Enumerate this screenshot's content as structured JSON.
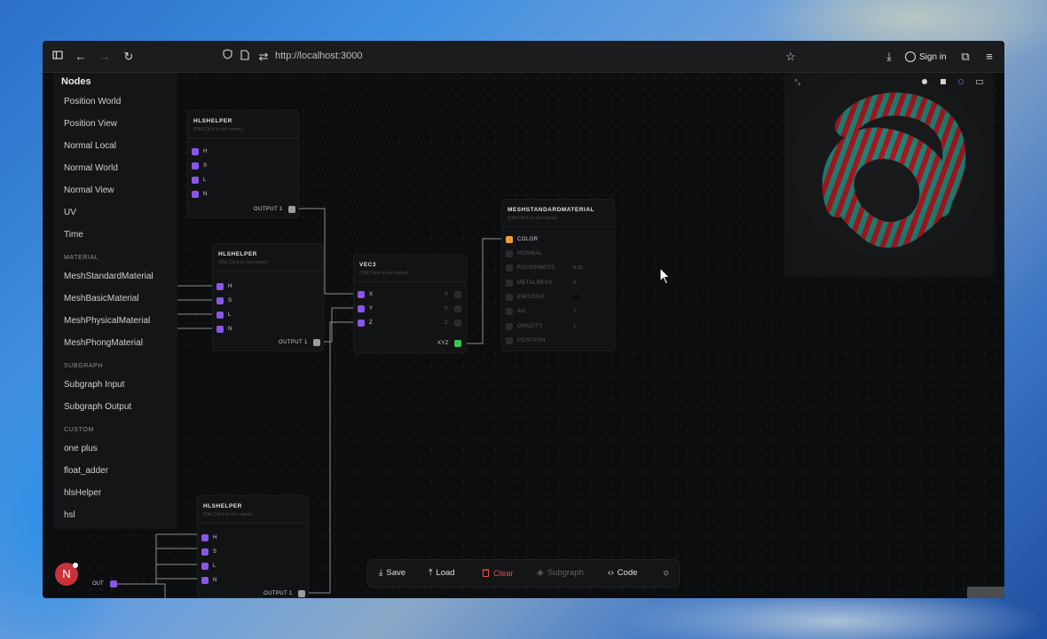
{
  "browser": {
    "url": "http://localhost:3000",
    "sign_in": "Sign in"
  },
  "sidebar": {
    "title": "Nodes",
    "items_top": [
      "Position World",
      "Position View",
      "Normal Local",
      "Normal World",
      "Normal View",
      "UV",
      "Time"
    ],
    "sections": [
      {
        "label": "MATERIAL",
        "items": [
          "MeshStandardMaterial",
          "MeshBasicMaterial",
          "MeshPhysicalMaterial",
          "MeshPhongMaterial"
        ]
      },
      {
        "label": "SUBGRAPH",
        "items": [
          "Subgraph Input",
          "Subgraph Output"
        ]
      },
      {
        "label": "CUSTOM",
        "items": [
          "one plus",
          "float_adder",
          "hlsHelper",
          "hsl"
        ]
      }
    ]
  },
  "nodes": {
    "hls1": {
      "title": "HLSHELPER",
      "subtitle": "(Dbl Click to set name)",
      "inputs": [
        "H",
        "S",
        "L",
        "N"
      ],
      "output": "OUTPUT 1"
    },
    "hls2": {
      "title": "HLSHELPER",
      "subtitle": "(Dbl Click to set name)",
      "inputs": [
        "H",
        "S",
        "L",
        "N"
      ],
      "output": "OUTPUT 1"
    },
    "hls3": {
      "title": "HLSHELPER",
      "subtitle": "(Dbl Click to set name)",
      "inputs": [
        "H",
        "S",
        "L",
        "N"
      ],
      "output": "OUTPUT 1"
    },
    "vec3": {
      "title": "VEC3",
      "subtitle": "(Dbl Click to set name)",
      "inputs": [
        "X",
        "Y",
        "Z"
      ],
      "right_labels": [
        "X",
        "Y",
        "Z"
      ],
      "output": "XYZ"
    },
    "mesh": {
      "title": "MESHSTANDARDMATERIAL",
      "subtitle": "(Dbl Click to set name)",
      "inputs": [
        "COLOR",
        "NORMAL",
        "ROUGHNESS",
        "METALNESS",
        "EMISSIVE",
        "AO",
        "OPACITY",
        "POSITION"
      ],
      "values": {
        "roughness": "0.10",
        "metalness": "0",
        "ao": "1",
        "opacity": "1"
      }
    }
  },
  "out_label": "OUT",
  "avatar_letter": "N",
  "toolbar": {
    "save": "Save",
    "load": "Load",
    "clear": "Clear",
    "subgraph": "Subgraph",
    "code": "Code"
  },
  "colors": {
    "port_input": "#8a56e8",
    "port_output": "#9c9ca2",
    "port_xyz": "#35c85a",
    "port_color": "#f0a030",
    "clear_red": "#e05050",
    "avatar": "#c8333a"
  }
}
